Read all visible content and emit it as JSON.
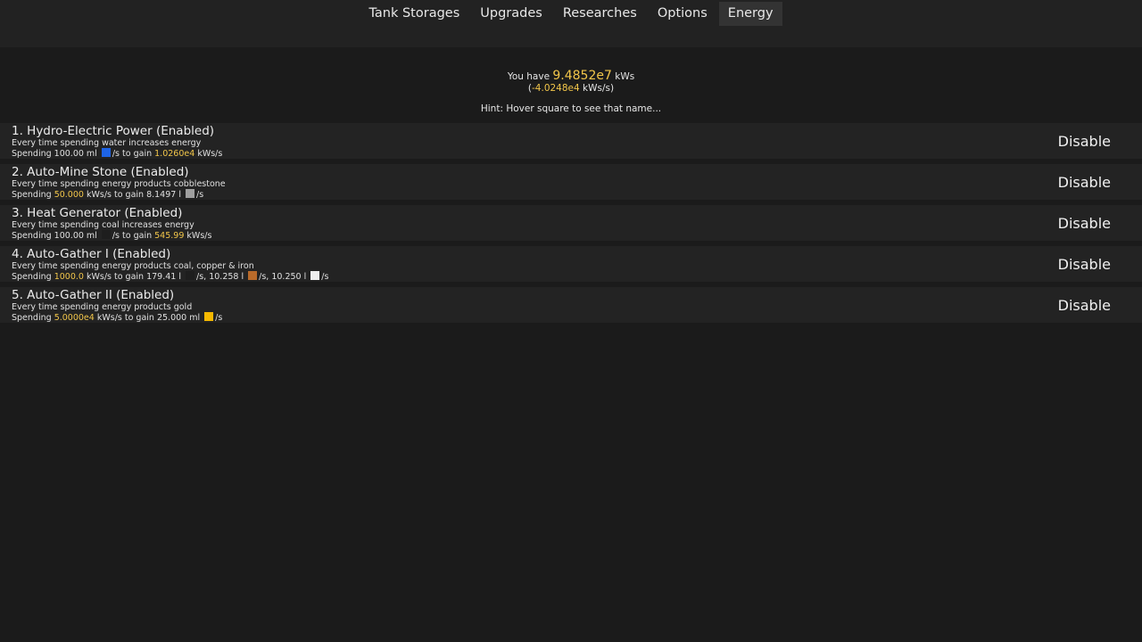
{
  "nav": {
    "tabs": [
      {
        "label": "Tank Storages"
      },
      {
        "label": "Upgrades"
      },
      {
        "label": "Researches"
      },
      {
        "label": "Options"
      },
      {
        "label": "Energy",
        "active": true
      }
    ]
  },
  "summary": {
    "prefix": "You have",
    "amount": "9.4852e7",
    "unit": "kWs",
    "rate_open": "(",
    "rate": "-4.0248e4",
    "rate_close": " kWs/s)",
    "hint": "Hint: Hover square to see that name..."
  },
  "colors": {
    "accent": "#f2c64a",
    "water": "#1e64e6",
    "stone": "#a0a0a0",
    "coal": "#1e1e1e",
    "copper": "#b86a2a",
    "iron": "#eeeeee",
    "gold": "#f5b800"
  },
  "generators": [
    {
      "title": "1. Hydro-Electric Power (Enabled)",
      "desc": "Every time spending water increases energy",
      "spend_pre": "Spending 100.00 ml",
      "spend_mid": "/s to gain",
      "gain": "1.0260e4",
      "spend_post": "kWs/s",
      "button": "Disable"
    },
    {
      "title": "2. Auto-Mine Stone (Enabled)",
      "desc": "Every time spending energy products cobblestone",
      "spend_pre": "Spending",
      "cost": "50.000",
      "spend_mid": "kWs/s to gain 8.1497 l",
      "spend_post": "/s",
      "button": "Disable"
    },
    {
      "title": "3. Heat Generator (Enabled)",
      "desc": "Every time spending coal increases energy",
      "spend_pre": "Spending 100.00 ml",
      "spend_mid": "/s to gain",
      "gain": "545.99",
      "spend_post": "kWs/s",
      "button": "Disable"
    },
    {
      "title": "4. Auto-Gather I (Enabled)",
      "desc": "Every time spending energy products coal, copper & iron",
      "spend_pre": "Spending",
      "cost": "1000.0",
      "spend_mid": "kWs/s to gain 179.41 l",
      "seg2": "/s, 10.258 l",
      "seg3": "/s, 10.250 l",
      "spend_post": "/s",
      "button": "Disable"
    },
    {
      "title": "5. Auto-Gather II (Enabled)",
      "desc": "Every time spending energy products gold",
      "spend_pre": "Spending",
      "cost": "5.0000e4",
      "spend_mid": "kWs/s to gain 25.000 ml",
      "spend_post": "/s",
      "button": "Disable"
    }
  ]
}
